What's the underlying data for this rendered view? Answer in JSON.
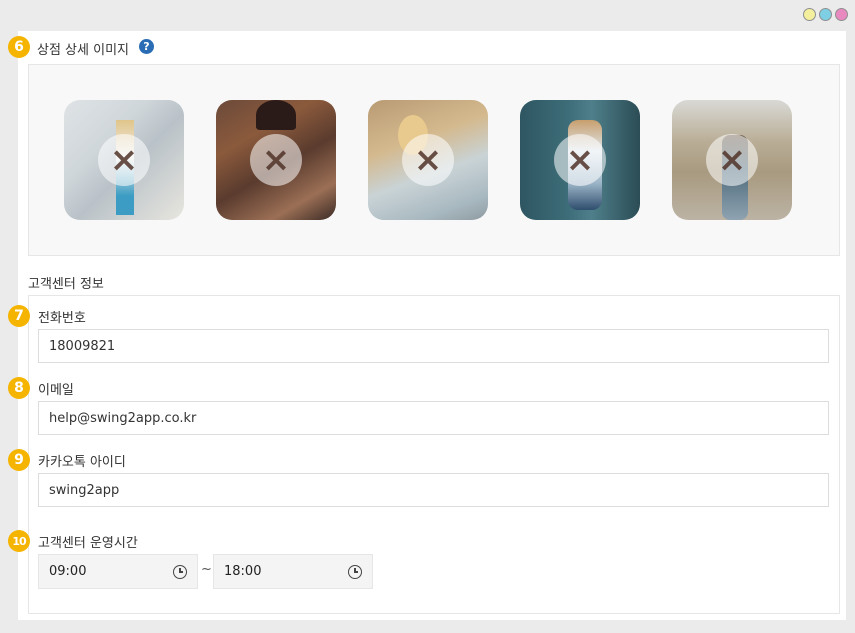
{
  "window": {
    "dots": [
      {
        "name": "yellow",
        "color": "#f3ef9d"
      },
      {
        "name": "blue",
        "color": "#7ecfe4"
      },
      {
        "name": "pink",
        "color": "#e88ac0"
      }
    ]
  },
  "detail_images": {
    "number": "6",
    "title": "상점 상세 이미지",
    "help_icon": "?",
    "images": [
      {
        "name": "image-1",
        "delete_icon": "×"
      },
      {
        "name": "image-2",
        "delete_icon": "×"
      },
      {
        "name": "image-3",
        "delete_icon": "×"
      },
      {
        "name": "image-4",
        "delete_icon": "×"
      },
      {
        "name": "image-5",
        "delete_icon": "×"
      }
    ]
  },
  "customer_center": {
    "section_title": "고객센터 정보",
    "phone": {
      "number": "7",
      "label": "전화번호",
      "value": "18009821"
    },
    "email": {
      "number": "8",
      "label": "이메일",
      "value": "help@swing2app.co.kr"
    },
    "kakao": {
      "number": "9",
      "label": "카카오톡 아이디",
      "value": "swing2app"
    },
    "hours": {
      "number": "10",
      "label": "고객센터 운영시간",
      "start": "09:00",
      "separator": "~",
      "end": "18:00"
    }
  }
}
